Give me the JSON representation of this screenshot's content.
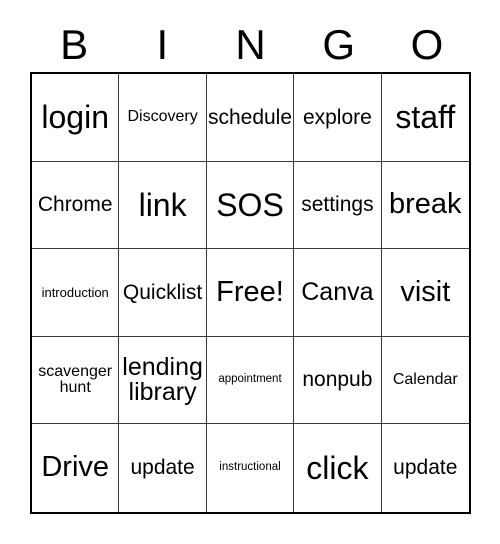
{
  "header": {
    "letters": [
      "B",
      "I",
      "N",
      "G",
      "O"
    ]
  },
  "grid": {
    "rows": [
      [
        {
          "text": "login",
          "size": "fs-xxl"
        },
        {
          "text": "Discovery",
          "size": "fs-sm"
        },
        {
          "text": "schedule",
          "size": "fs-md"
        },
        {
          "text": "explore",
          "size": "fs-md"
        },
        {
          "text": "staff",
          "size": "fs-xxl"
        }
      ],
      [
        {
          "text": "Chrome",
          "size": "fs-md"
        },
        {
          "text": "link",
          "size": "fs-xxl"
        },
        {
          "text": "SOS",
          "size": "fs-xxl"
        },
        {
          "text": "settings",
          "size": "fs-md"
        },
        {
          "text": "break",
          "size": "fs-xl"
        }
      ],
      [
        {
          "text": "introduction",
          "size": "fs-xs"
        },
        {
          "text": "Quicklist",
          "size": "fs-md"
        },
        {
          "text": "Free!",
          "size": "fs-xl"
        },
        {
          "text": "Canva",
          "size": "fs-lg"
        },
        {
          "text": "visit",
          "size": "fs-xl"
        }
      ],
      [
        {
          "text": "scavenger\nhunt",
          "size": "fs-sm"
        },
        {
          "text": "lending\nlibrary",
          "size": "fs-lg"
        },
        {
          "text": "appointment",
          "size": "fs-xxs"
        },
        {
          "text": "nonpub",
          "size": "fs-md"
        },
        {
          "text": "Calendar",
          "size": "fs-sm"
        }
      ],
      [
        {
          "text": "Drive",
          "size": "fs-xl"
        },
        {
          "text": "update",
          "size": "fs-md"
        },
        {
          "text": "instructional",
          "size": "fs-xxs"
        },
        {
          "text": "click",
          "size": "fs-xxl"
        },
        {
          "text": "update",
          "size": "fs-md"
        }
      ]
    ]
  },
  "colors": {
    "background": "#ffffff",
    "text": "#000000",
    "outer_border": "#000000",
    "inner_border": "#3a3a3a"
  }
}
